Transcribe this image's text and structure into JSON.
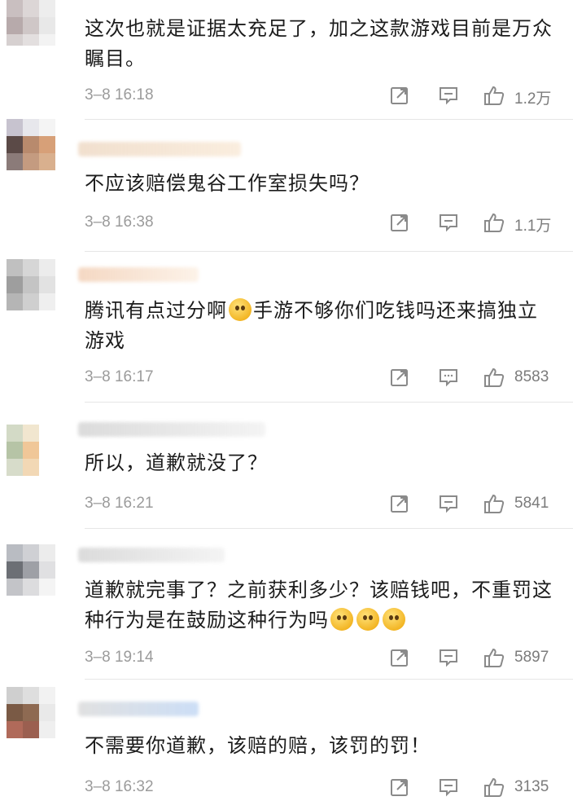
{
  "comments": [
    {
      "text": "这次也就是证据太充足了，加之这款游戏目前是万众瞩目。",
      "time": "3–8 16:18",
      "likes": "1.2万",
      "avatar": [
        "#c9bfc0",
        "#dcd6d6",
        "#ededed",
        "#b7aaab",
        "#cfc7c7",
        "#e8e8e8",
        "#d6d0d0",
        "#e3dfdf",
        "#f3f3f3"
      ]
    },
    {
      "text": "不应该赔偿鬼谷工作室损失吗？",
      "time": "3–8 16:38",
      "likes": "1.1万",
      "avatar": [
        "#c7c3cf",
        "#e7e7ec",
        "#f4f4f4",
        "#5b4a47",
        "#b88a6d",
        "#d7a078",
        "#8b7b79",
        "#c49b80",
        "#d9b08e"
      ]
    },
    {
      "text": "腾讯有点过分啊",
      "text_after_emoji": "手游不够你们吃钱吗还来搞独立游戏",
      "time": "3–8 16:17",
      "likes": "8583",
      "avatar": [
        "#c0c0c0",
        "#d6d6d6",
        "#ececec",
        "#9e9e9e",
        "#c4c4c4",
        "#e2e2e2",
        "#b5b5b5",
        "#cfcfcf",
        "#efefef"
      ]
    },
    {
      "text": "所以，道歉就没了？",
      "time": "3–8 16:21",
      "likes": "5841",
      "avatar": [
        "#d3dac6",
        "#f1e6cf",
        "#ffffff",
        "#b6c4a6",
        "#f0c798",
        "#ffffff",
        "#d7dcca",
        "#f2d8b5",
        "#ffffff"
      ]
    },
    {
      "text": "道歉就完事了？之前获利多少？该赔钱吧，不重罚这种行为是在鼓励这种行为吗",
      "time": "3–8 19:14",
      "likes": "5897",
      "avatar": [
        "#b9bcc2",
        "#cfd0d4",
        "#ececec",
        "#6c6f75",
        "#9ea0a6",
        "#e0e0e2",
        "#c3c4c8",
        "#dcdcde",
        "#f4f4f4"
      ]
    },
    {
      "text": "不需要你道歉，该赔的赔，该罚的罚！",
      "time": "3–8 16:32",
      "likes": "3135",
      "avatar": [
        "#cfcfcf",
        "#dedede",
        "#f2f2f2",
        "#7a5a45",
        "#8e6a52",
        "#e9e9e9",
        "#b06a5a",
        "#9b5f50",
        "#efefef"
      ]
    }
  ],
  "icons": {
    "share": "share-arrow-icon",
    "reply": "comment-bubble-icon",
    "like": "thumbs-up-icon",
    "emoji": "dizzy-face-emoji"
  }
}
